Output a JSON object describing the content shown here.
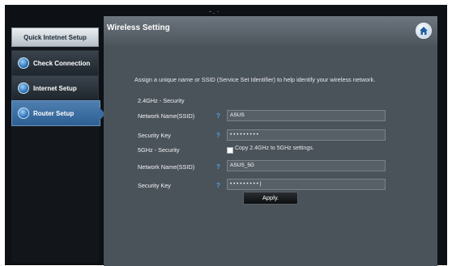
{
  "topbar": {
    "deco_text": "-.·"
  },
  "sidebar": {
    "header": "Quick Intetnet Setup",
    "items": [
      {
        "label": "Check Connection",
        "icon": "globe-icon"
      },
      {
        "label": "Internet Setup",
        "icon": "globe-icon"
      },
      {
        "label": "Router Setup",
        "icon": "globe-icon",
        "active": true
      }
    ]
  },
  "main": {
    "title": "Wireless Setting",
    "home_icon": "home-icon",
    "description": "Assign a unique name or SSID (Service Set Identifier) to help identify your wireless network.",
    "band_24": {
      "section_title": "2.4GHz - Security",
      "ssid_label": "Network Name(SSID)",
      "ssid_value": "ASUS",
      "key_label": "Security Key",
      "key_value": "• • • • • • • • •"
    },
    "band_5": {
      "section_title": "5GHz - Security",
      "copy_label": "Copy 2.4GHz to 5GHz settings.",
      "copy_checked": false,
      "ssid_label": "Network Name(SSID)",
      "ssid_value": "ASUS_5G",
      "key_label": "Security Key",
      "key_value": "• • • • • • • • • |"
    },
    "apply_label": "Apply."
  },
  "colors": {
    "panel_bg": "#4b535a",
    "active_nav": "#3a6c9f",
    "help_icon": "#4aa3e8"
  }
}
